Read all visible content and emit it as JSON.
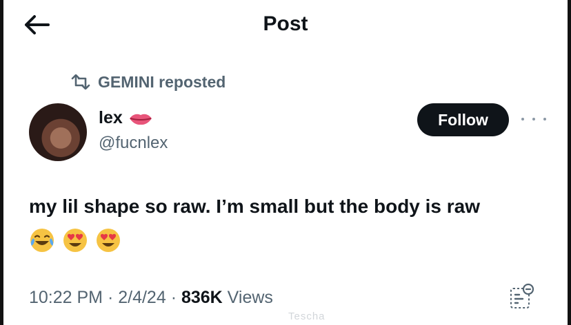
{
  "header": {
    "title": "Post",
    "back_icon": "arrow-left-icon"
  },
  "repost": {
    "icon": "repost-icon",
    "text": "GEMINI reposted"
  },
  "author": {
    "name": "lex",
    "name_emoji": "lips-icon",
    "handle": "@fucnlex"
  },
  "follow_button": {
    "label": "Follow"
  },
  "more_icon": "more-dots-icon",
  "post": {
    "text": "my lil shape so raw. I’m small but the body is raw",
    "emojis": [
      "laughing-tears-emoji",
      "heart-eyes-emoji",
      "heart-eyes-emoji"
    ]
  },
  "meta": {
    "time": "10:22 PM",
    "sep1": " · ",
    "date": "2/4/24",
    "sep2": " · ",
    "views_count": "836K",
    "views_label": " Views"
  },
  "qr_icon": "qr-scan-icon",
  "watermark": "Tescha"
}
